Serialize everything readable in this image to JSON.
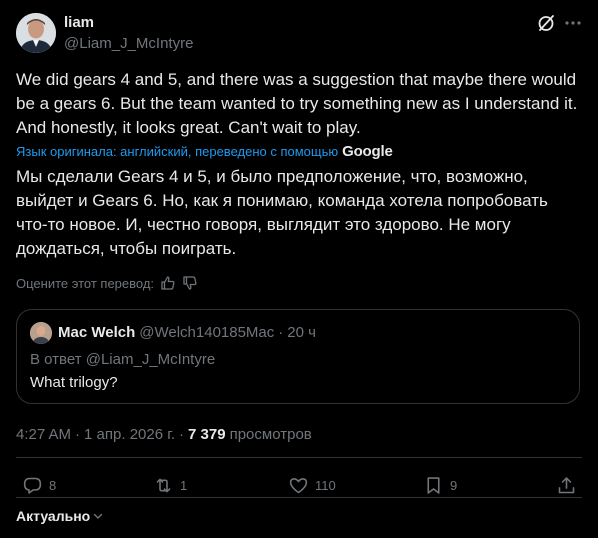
{
  "author": {
    "name": "liam",
    "handle": "@Liam_J_McIntyre"
  },
  "tweet": {
    "text": "We did gears 4 and 5, and there was a suggestion that maybe there would be a gears 6. But the team wanted to try something new as I understand it. And honestly, it looks great. Can't wait to play.",
    "translation_note": "Язык оригинала: английский, переведено с помощью",
    "translation_provider": "Google",
    "translated_text": "Мы сделали Gears 4 и 5, и было предположение, что, возможно, выйдет и Gears 6. Но, как я понимаю, команда хотела попробовать что-то новое. И, честно говоря, выглядит это здорово. Не могу дождаться, чтобы поиграть.",
    "rate_translation_label": "Оцените этот перевод:"
  },
  "quote": {
    "name": "Mac Welch",
    "handle": "@Welch140185Mac",
    "separator": "·",
    "time": "20 ч",
    "reply_to": "В ответ @Liam_J_McIntyre",
    "text": "What trilogy?"
  },
  "meta": {
    "time": "4:27 AM",
    "separator": "·",
    "date": "1 апр. 2026 г.",
    "separator2": "·",
    "views_count": "7 379",
    "views_label": "просмотров"
  },
  "actions": {
    "replies": "8",
    "reposts": "1",
    "likes": "110",
    "bookmarks": "9"
  },
  "sort": {
    "label": "Актуально"
  },
  "colors": {
    "background": "#000000",
    "text": "#e7e9ea",
    "secondary": "#71767b",
    "accent": "#1d9bf0",
    "border": "#2f3336"
  },
  "icons": [
    "grok-icon",
    "more-icon",
    "thumbs-up-icon",
    "thumbs-down-icon",
    "reply-icon",
    "repost-icon",
    "like-icon",
    "bookmark-icon",
    "share-icon",
    "chevron-down-icon"
  ]
}
